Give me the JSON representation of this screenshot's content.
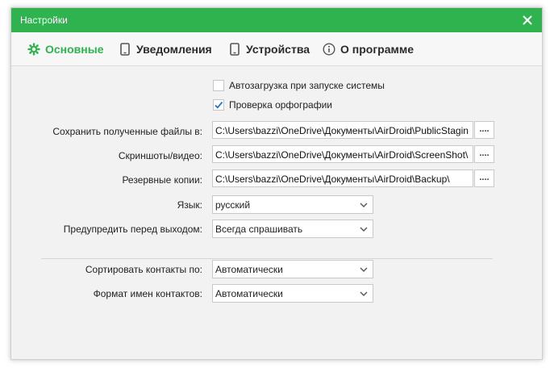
{
  "window": {
    "title": "Настройки",
    "accent_color": "#2eb34f"
  },
  "tabs": [
    {
      "label": "Основные",
      "icon": "gear-icon",
      "active": true
    },
    {
      "label": "Уведомления",
      "icon": "phone-icon",
      "active": false
    },
    {
      "label": "Устройства",
      "icon": "phone-icon",
      "active": false
    },
    {
      "label": "О программе",
      "icon": "info-icon",
      "active": false
    }
  ],
  "checkboxes": {
    "autostart": {
      "label": "Автозагрузка при запуске системы",
      "checked": false
    },
    "spellcheck": {
      "label": "Проверка орфографии",
      "checked": true
    }
  },
  "paths": {
    "received_files": {
      "label": "Сохранить полученные файлы в:",
      "value": "C:\\Users\\bazzi\\OneDrive\\Документы\\AirDroid\\PublicStagin"
    },
    "screenshots": {
      "label": "Скриншоты/видео:",
      "value": "C:\\Users\\bazzi\\OneDrive\\Документы\\AirDroid\\ScreenShot\\"
    },
    "backups": {
      "label": "Резервные копии:",
      "value": "C:\\Users\\bazzi\\OneDrive\\Документы\\AirDroid\\Backup\\"
    },
    "browse_label": "...."
  },
  "language": {
    "label": "Язык:",
    "value": "русский"
  },
  "exit_warning": {
    "label": "Предупредить перед выходом:",
    "value": "Всегда спрашивать"
  },
  "contacts": {
    "sort": {
      "label": "Сортировать контакты по:",
      "value": "Автоматически"
    },
    "name_format": {
      "label": "Формат имен контактов:",
      "value": "Автоматически"
    }
  }
}
